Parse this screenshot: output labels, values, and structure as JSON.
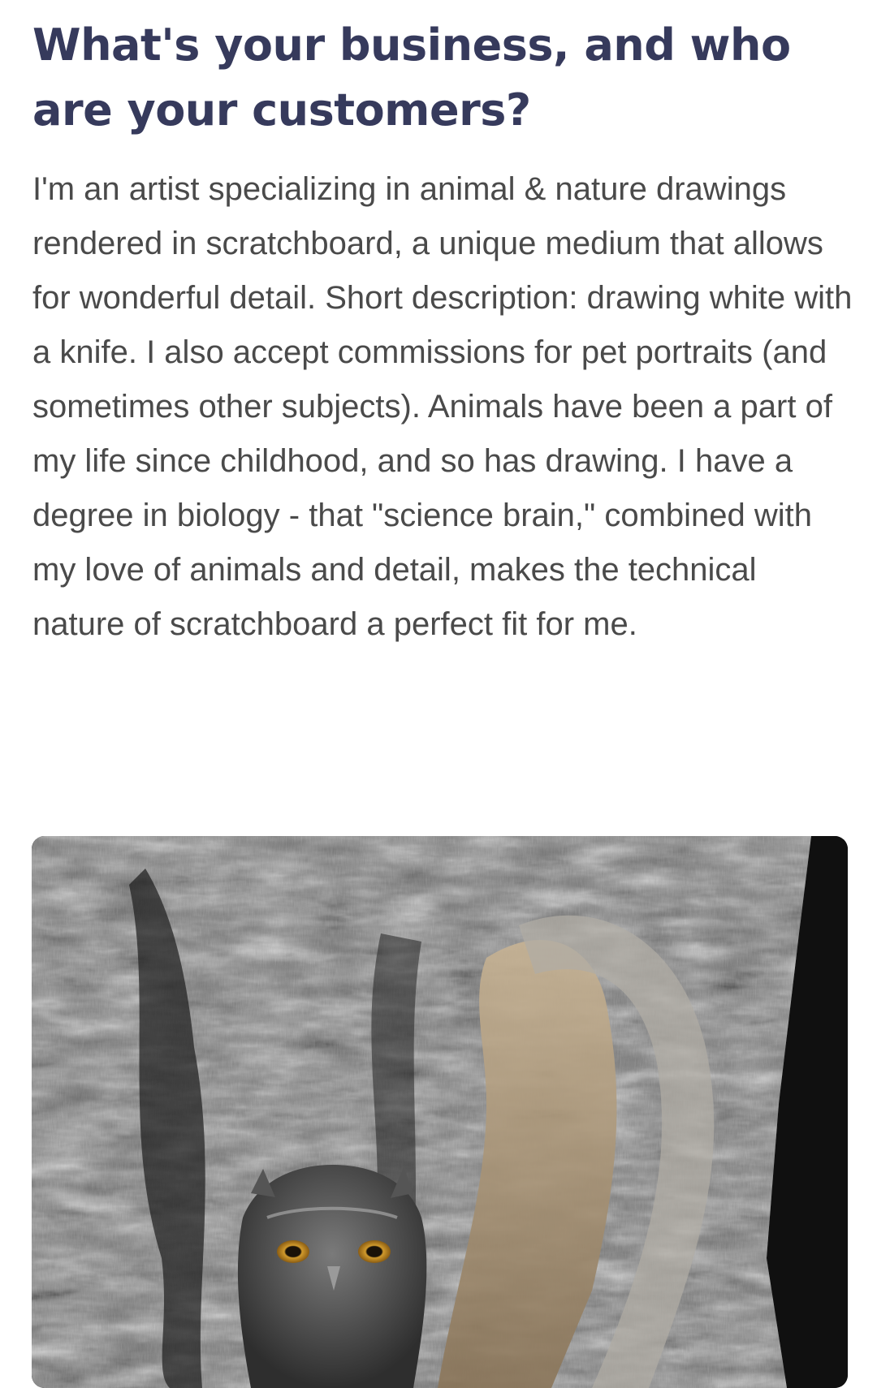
{
  "article": {
    "question": "What's your business, and who are your customers?",
    "answer": "I'm an artist specializing in animal & nature drawings rendered in scratchboard, a unique medium that allows for wonderful detail. Short description: drawing white with a knife. I also accept commissions for pet portraits (and sometimes other subjects). Animals have been a part of my life since childhood, and so has drawing. I have a degree in biology - that \"science brain,\" combined with my love of animals and detail, makes the technical nature of scratchboard a perfect fit for me."
  },
  "colors": {
    "heading": "#363a5c",
    "body_text": "#4a4a4a",
    "background": "#ffffff"
  }
}
